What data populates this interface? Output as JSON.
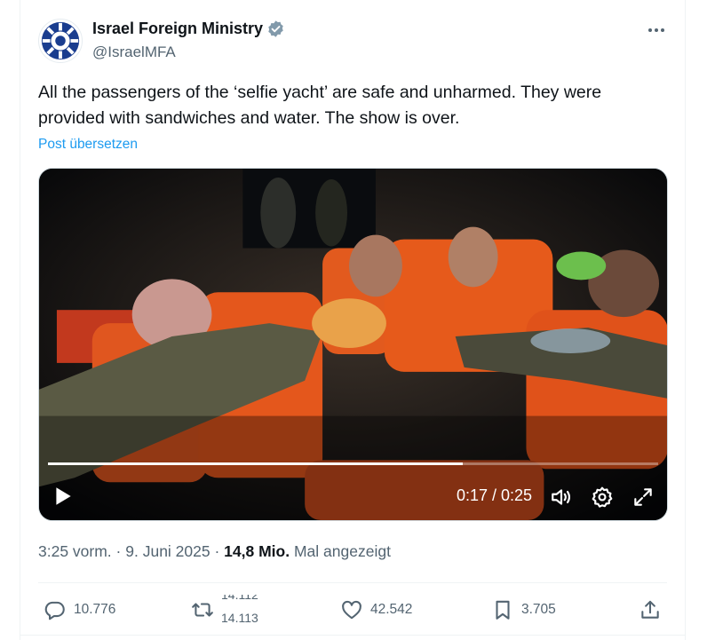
{
  "author": {
    "name": "Israel Foreign Ministry",
    "handle": "@IsraelMFA",
    "verified": true
  },
  "post": {
    "text": "All the passengers of the ‘selfie yacht’ are safe and unharmed. They were provided with sandwiches and water. The show is over.",
    "translate_label": "Post übersetzen"
  },
  "video": {
    "time_readout": "0:17 / 0:25",
    "progress": 0.68
  },
  "meta": {
    "time": "3:25 vorm.",
    "separator": " · ",
    "date": "9. Juni 2025",
    "views": "14,8 Mio.",
    "views_label": "Mal angezeigt"
  },
  "actions": {
    "replies": "10.776",
    "reposts_old": "14.112",
    "reposts_new": "14.113",
    "likes": "42.542",
    "bookmarks": "3.705"
  },
  "colors": {
    "accent": "#1d9bf0",
    "secondary_text": "#536471",
    "primary_text": "#0f1419",
    "verified": "#829aab"
  },
  "icons": [
    "more-icon",
    "verified-icon",
    "play-icon",
    "volume-icon",
    "settings-icon",
    "fullscreen-icon",
    "reply-icon",
    "repost-icon",
    "like-icon",
    "bookmark-icon",
    "share-icon"
  ]
}
